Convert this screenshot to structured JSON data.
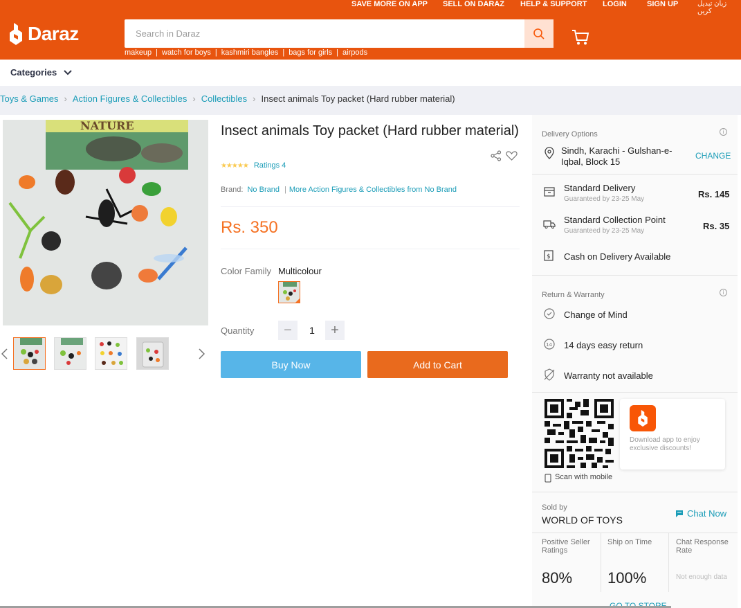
{
  "header": {
    "topnav": [
      "SAVE MORE ON APP",
      "SELL ON DARAZ",
      "HELP & SUPPORT",
      "LOGIN",
      "SIGN UP",
      "زبان تبدیل کریں"
    ],
    "logo_text": "Daraz",
    "search_placeholder": "Search in Daraz",
    "suggestions": [
      "makeup",
      "watch for boys",
      "kashmiri bangles",
      "bags for girls",
      "airpods"
    ],
    "brand_color": "#e8540e"
  },
  "categories_label": "Categories",
  "breadcrumb": [
    "Toys & Games",
    "Action Figures & Collectibles",
    "Collectibles",
    "Insect animals Toy packet (Hard rubber material)"
  ],
  "product": {
    "title": "Insect animals Toy packet (Hard rubber material)",
    "ratings_label": "Ratings 4",
    "brand_label": "Brand:",
    "brand_value": "No Brand",
    "brand_more": "More Action Figures & Collectibles from No Brand",
    "price": "Rs. 350",
    "color_family_label": "Color Family",
    "color_family_value": "Multicolour",
    "quantity_label": "Quantity",
    "quantity_value": "1",
    "buy_now": "Buy Now",
    "add_to_cart": "Add to Cart",
    "gallery_image_text": "NATURE"
  },
  "delivery": {
    "section_title": "Delivery Options",
    "location": "Sindh, Karachi - Gulshan-e-Iqbal, Block 15",
    "change": "CHANGE",
    "options": [
      {
        "name": "Standard Delivery",
        "sub": "Guaranteed by 23-25 May",
        "price": "Rs. 145"
      },
      {
        "name": "Standard Collection Point",
        "sub": "Guaranteed by 23-25 May",
        "price": "Rs. 35"
      }
    ],
    "cod": "Cash on Delivery Available"
  },
  "warranty": {
    "section_title": "Return & Warranty",
    "items": [
      "Change of Mind",
      "14 days easy return",
      "Warranty not available"
    ]
  },
  "app": {
    "scan": "Scan with mobile",
    "promo": "Download app to enjoy exclusive discounts!"
  },
  "seller": {
    "sold_by": "Sold by",
    "name": "WORLD OF TOYS",
    "chat": "Chat Now",
    "stats": [
      {
        "label": "Positive Seller Ratings",
        "value": "80%"
      },
      {
        "label": "Ship on Time",
        "value": "100%"
      },
      {
        "label": "Chat Response Rate",
        "value": "Not enough data"
      }
    ],
    "go_to_store": "GO TO STORE"
  }
}
